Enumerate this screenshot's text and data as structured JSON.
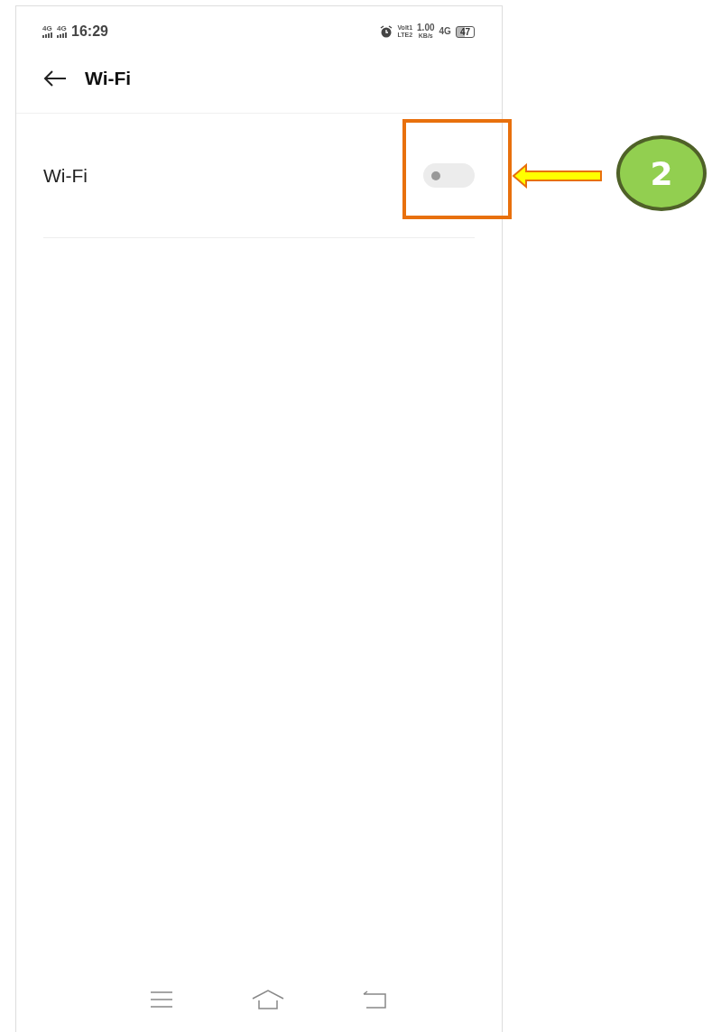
{
  "status_bar": {
    "network_1": "4G",
    "network_2": "4G",
    "time": "16:29",
    "volte_top": "Volt1",
    "volte_bottom": "LTE2",
    "speed": "1.00",
    "speed_unit": "KB/s",
    "network_3": "4G",
    "battery": "47"
  },
  "header": {
    "title": "Wi-Fi"
  },
  "settings": [
    {
      "kind": "toggle",
      "label": "Wi-Fi",
      "on": false
    }
  ],
  "annotation": {
    "number": "2"
  }
}
